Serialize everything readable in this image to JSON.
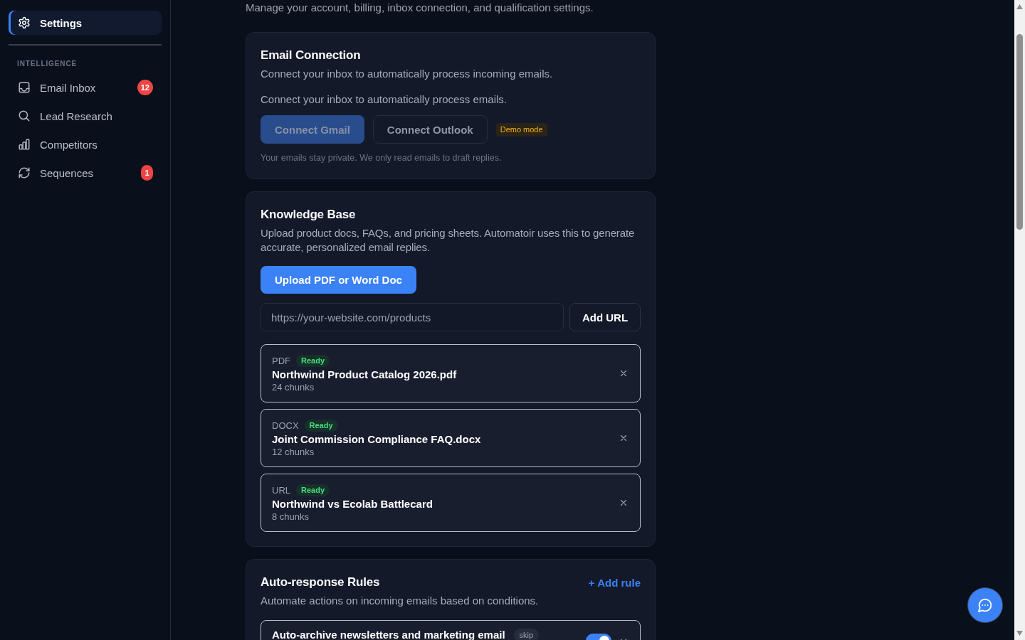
{
  "sidebar": {
    "items": [
      {
        "label": "Settings",
        "selected": true
      }
    ],
    "sections": [
      {
        "heading": "INTELLIGENCE",
        "items": [
          {
            "label": "Email Inbox",
            "selected": false,
            "badge": "12"
          },
          {
            "label": "Lead Research",
            "selected": false
          },
          {
            "label": "Competitors",
            "selected": false
          },
          {
            "label": "Sequences",
            "selected": false,
            "badge": "1"
          }
        ]
      }
    ]
  },
  "page": {
    "subtitle": "Manage your account, billing, inbox connection, and qualification settings."
  },
  "email_connection": {
    "title": "Email Connection",
    "description": "Connect your inbox to automatically process incoming emails.",
    "note": "Connect your inbox to automatically process emails.",
    "buttons": [
      {
        "label": "Connect Gmail",
        "kind": "primary",
        "disabled": true
      },
      {
        "label": "Connect Outlook",
        "kind": "secondary",
        "disabled": true
      }
    ],
    "badge": "Demo mode",
    "footnote": "Your emails stay private. We only read emails to draft replies."
  },
  "knowledge_base": {
    "title": "Knowledge Base",
    "description": "Upload product docs, FAQs, and pricing sheets. Automatoir uses this to generate accurate, personalized email replies.",
    "upload_button": "Upload PDF or Word Doc",
    "url_field": {
      "placeholder": "https://your-website.com/products"
    },
    "add_url_button": "Add URL",
    "documents": [
      {
        "type": "PDF",
        "status": "Ready",
        "name": "Northwind Product Catalog 2026.pdf",
        "chunks": "24 chunks"
      },
      {
        "type": "DOCX",
        "status": "Ready",
        "name": "Joint Commission Compliance FAQ.docx",
        "chunks": "12 chunks"
      },
      {
        "type": "URL",
        "status": "Ready",
        "name": "Northwind vs Ecolab Battlecard",
        "chunks": "8 chunks"
      }
    ]
  },
  "auto_response_rules": {
    "title": "Auto-response Rules",
    "add_button": "+ Add rule",
    "description": "Automate actions on incoming emails based on conditions.",
    "rules": [
      {
        "name": "Auto-archive newsletters and marketing email",
        "action": "skip",
        "on": true
      }
    ]
  }
}
